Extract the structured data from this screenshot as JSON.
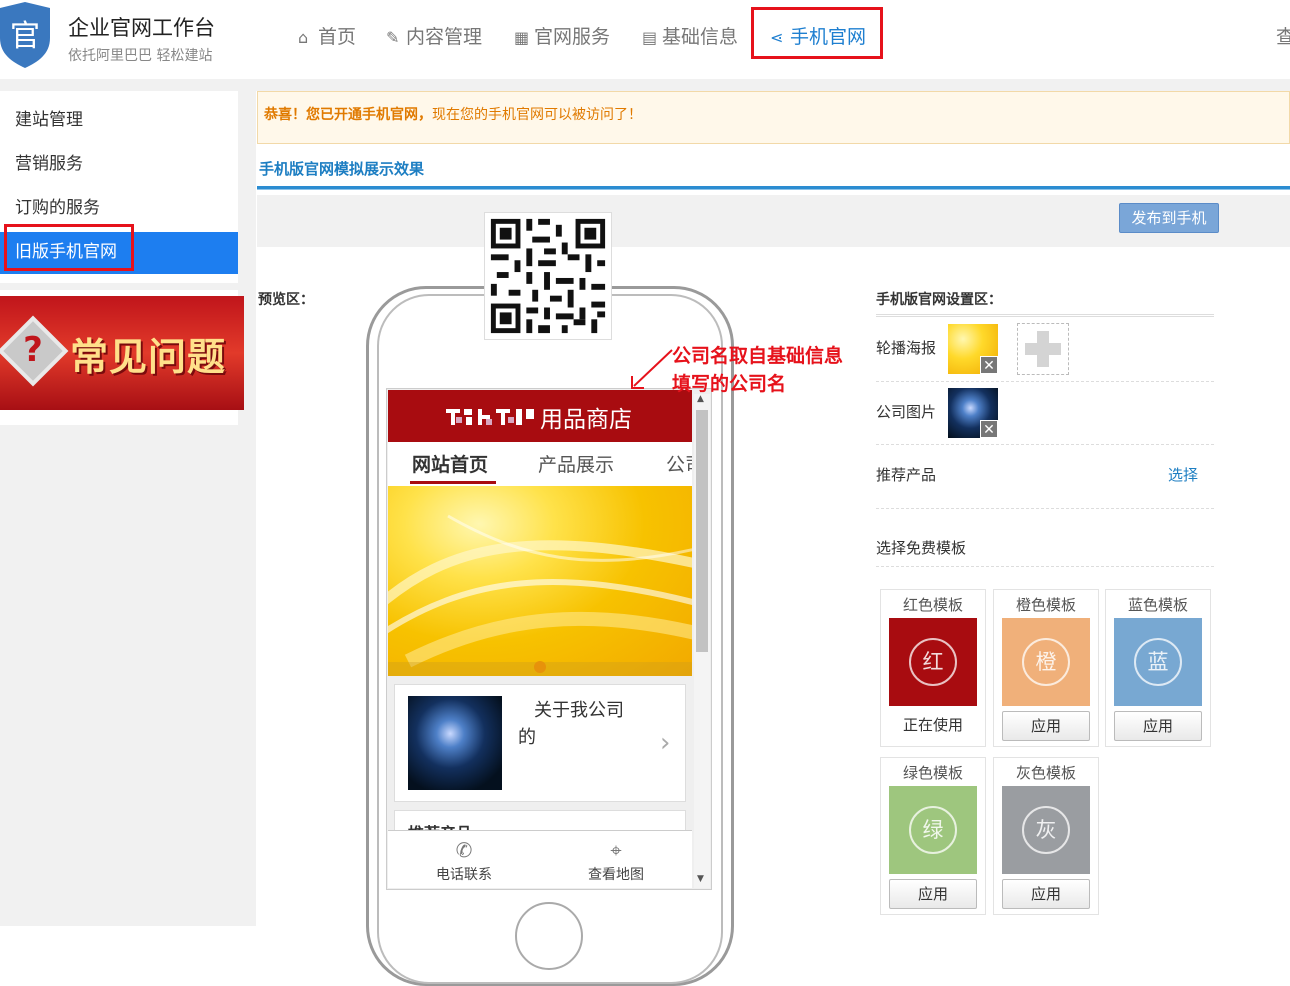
{
  "header": {
    "logo_char": "官",
    "title": "企业官网工作台",
    "subtitle": "依托阿里巴巴 轻松建站",
    "nav": [
      {
        "label": "首页",
        "icon": "home-icon"
      },
      {
        "label": "内容管理",
        "icon": "edit-icon"
      },
      {
        "label": "官网服务",
        "icon": "grid-icon"
      },
      {
        "label": "基础信息",
        "icon": "document-icon"
      },
      {
        "label": "手机官网",
        "icon": "share-icon"
      }
    ],
    "edge_char": "查"
  },
  "sidebar": {
    "items": [
      {
        "label": "建站管理"
      },
      {
        "label": "营销服务"
      },
      {
        "label": "订购的服务"
      },
      {
        "label": "旧版手机官网"
      }
    ],
    "faq_text": "常见问题"
  },
  "notice": {
    "prefix": "恭喜！您已开通手机官网，",
    "suffix": "现在您的手机官网可以被访问了！"
  },
  "simulation_title": "手机版官网模拟展示效果",
  "publish_label": "发布到手机",
  "preview_label": "预览区：",
  "phone": {
    "site_name": "用品商店",
    "tabs": [
      "网站首页",
      "产品展示",
      "公司"
    ],
    "about_text": "关于我公司的",
    "recommend_label": "推荐产品",
    "footer": [
      {
        "label": "电话联系",
        "icon": "phone-icon"
      },
      {
        "label": "查看地图",
        "icon": "map-pin-icon"
      }
    ]
  },
  "annotation": {
    "line1": "公司名取自基础信息",
    "line2": "填写的公司名"
  },
  "settings": {
    "title": "手机版官网设置区：",
    "banner_label": "轮播海报",
    "company_image_label": "公司图片",
    "recommend_label": "推荐产品",
    "select_link": "选择",
    "template_title": "选择免费模板",
    "apply_label": "应用",
    "in_use_label": "正在使用",
    "templates": [
      {
        "name": "红色模板",
        "char": "红",
        "color": "#a80c10",
        "status": "正在使用"
      },
      {
        "name": "橙色模板",
        "char": "橙",
        "color": "#f0b07a",
        "status": "应用"
      },
      {
        "name": "蓝色模板",
        "char": "蓝",
        "color": "#78a8d2",
        "status": "应用"
      },
      {
        "name": "绿色模板",
        "char": "绿",
        "color": "#9ec67e",
        "status": "应用"
      },
      {
        "name": "灰色模板",
        "char": "灰",
        "color": "#9a9da1",
        "status": "应用"
      }
    ]
  },
  "colors": {
    "accent_blue": "#1d7ef0",
    "highlight_red": "#e6121b",
    "notice_orange": "#e07a00"
  }
}
